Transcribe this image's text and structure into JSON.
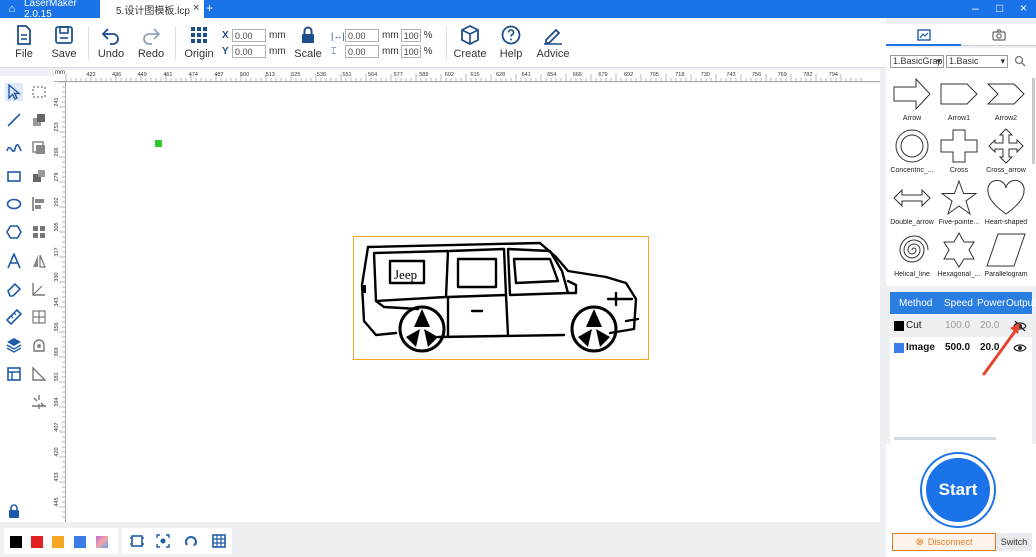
{
  "titlebar": {
    "app_name": "LaserMaker 2.0.15",
    "tab_label": "5.设计图模板.lcp",
    "tab_close": "×",
    "new_tab": "+",
    "minimize": "–",
    "maximize": "□",
    "close": "×"
  },
  "toolbar": {
    "file": "File",
    "save": "Save",
    "undo": "Undo",
    "redo": "Redo",
    "origin": "Origin",
    "x_label": "X",
    "y_label": "Y",
    "x_value": "0.00",
    "y_value": "0.00",
    "unit": "mm",
    "scale": "Scale",
    "width_value": "0.00",
    "height_value": "0.00",
    "width_pct": "100",
    "height_pct": "100",
    "pct": "%",
    "create": "Create",
    "help": "Help",
    "advice": "Advice"
  },
  "ruler": {
    "top_ticks": [
      "423",
      "436",
      "449",
      "461",
      "474",
      "487",
      "500",
      "513",
      "525",
      "538",
      "551",
      "564",
      "577",
      "589",
      "602",
      "615",
      "628",
      "641",
      "654",
      "666",
      "679",
      "692",
      "705",
      "718",
      "730",
      "743",
      "756",
      "769",
      "782",
      "794"
    ],
    "left_ticks": [
      "241",
      "253",
      "266",
      "279",
      "292",
      "305",
      "317",
      "330",
      "343",
      "356",
      "369",
      "381",
      "394",
      "407",
      "420",
      "433",
      "445",
      "458"
    ],
    "unit": "mm"
  },
  "shapes_panel": {
    "category": "1.BasicGrap",
    "subcategory": "1.Basic",
    "items": [
      "Arrow",
      "Arrow1",
      "Arrow2",
      "Concentric_...",
      "Cross",
      "Cross_arrow",
      "Double_arrow",
      "Five-pointe...",
      "Heart-shaped",
      "Helical_line",
      "Hexagonal_...",
      "Parallelogram"
    ]
  },
  "layers": {
    "headers": {
      "method": "Method",
      "speed": "Speed",
      "power": "Power",
      "output": "Output"
    },
    "rows": [
      {
        "name": "Cut",
        "speed": "100.0",
        "power": "20.0",
        "color": "#000000"
      },
      {
        "name": "Image",
        "speed": "500.0",
        "power": "20.0",
        "color": "#3b7de8"
      }
    ]
  },
  "machine": {
    "start": "Start",
    "disconnect": "Disconnect",
    "switch": "Switch"
  },
  "canvas": {
    "image_label": "Jeep"
  },
  "colors": {
    "accent": "#1a73e8",
    "selection": "#f5a623",
    "annotation_arrow": "#e8452c",
    "swatches": [
      "#000000",
      "#e02020",
      "#f5a623",
      "#3b7de8",
      "#c26bd6"
    ]
  }
}
